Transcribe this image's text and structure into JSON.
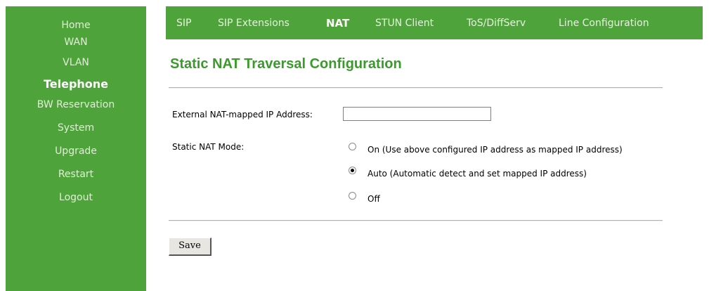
{
  "sidebar": {
    "items": [
      {
        "label": "Home"
      },
      {
        "label": "WAN"
      },
      {
        "label": "VLAN"
      },
      {
        "label": "Telephone",
        "active": true
      },
      {
        "label": "BW Reservation"
      },
      {
        "label": "System"
      },
      {
        "label": "Upgrade"
      },
      {
        "label": "Restart"
      },
      {
        "label": "Logout"
      }
    ]
  },
  "tabs": [
    {
      "label": "SIP"
    },
    {
      "label": "SIP Extensions"
    },
    {
      "label": "NAT",
      "active": true
    },
    {
      "label": "STUN Client"
    },
    {
      "label": "ToS/DiffServ"
    },
    {
      "label": "Line Configuration"
    }
  ],
  "main": {
    "title": "Static NAT Traversal Configuration",
    "external_ip_label": "External NAT-mapped IP Address:",
    "external_ip_value": "",
    "mode_label": "Static NAT Mode:",
    "mode_options": [
      {
        "label": "On (Use above configured IP address as mapped IP address)",
        "checked": false
      },
      {
        "label": "Auto (Automatic detect and set mapped IP address)",
        "checked": true
      },
      {
        "label": "Off",
        "checked": false
      }
    ],
    "save_label": "Save"
  },
  "colors": {
    "nav_green": "#4fa33b",
    "title_green": "#3b9a2c"
  }
}
